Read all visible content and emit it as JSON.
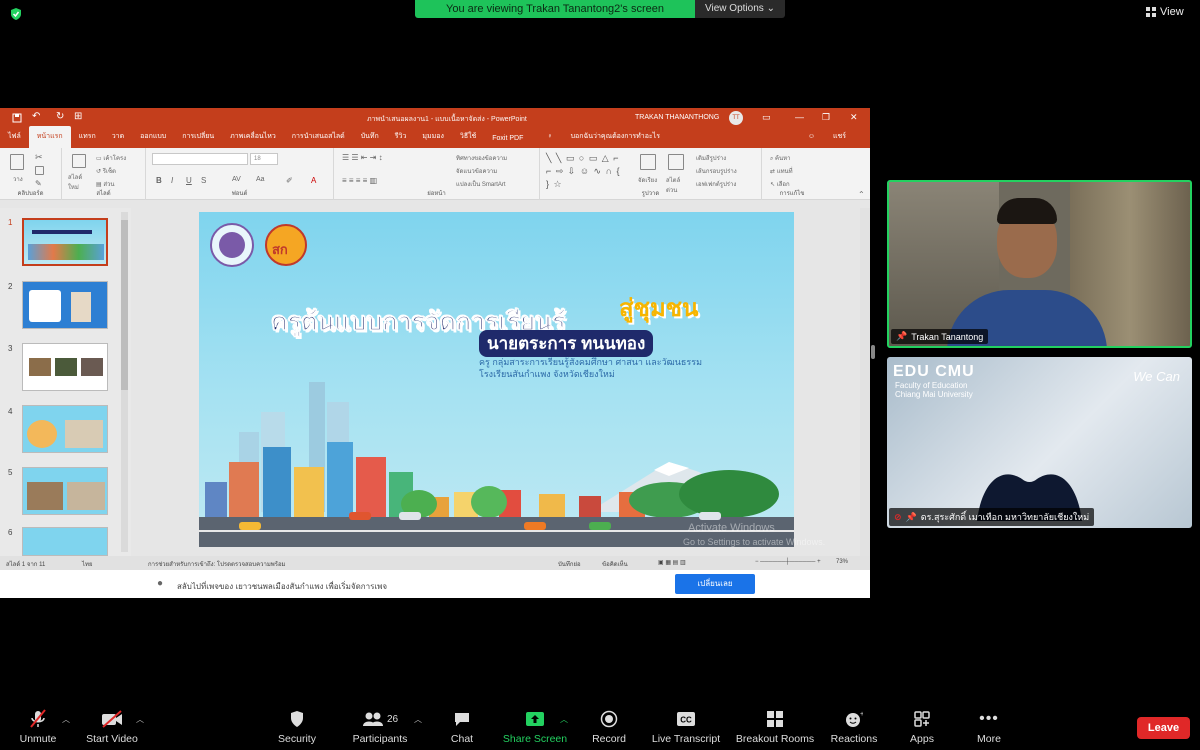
{
  "banner": {
    "text": "You are viewing Trakan Tanantong2's screen",
    "view_options": "View Options"
  },
  "view_button": "View",
  "ppt": {
    "doc_title": "ภาพนำเสนอผลงาน1 - แบบเนื้อหาจัดส่ง - PowerPoint",
    "user_name": "TRAKAN THANANTHONG",
    "user_initials": "TT",
    "tabs": [
      "ไฟล์",
      "หน้าแรก",
      "แทรก",
      "วาด",
      "ออกแบบ",
      "การเปลี่ยน",
      "ภาพเคลื่อนไหว",
      "การนำเสนอสไลด์",
      "บันทึก",
      "รีวิว",
      "มุมมอง",
      "วิธีใช้",
      "Foxit PDF",
      "บอกฉันว่าคุณต้องการทำอะไร"
    ],
    "share_label": "แชร์",
    "ribbon": {
      "clipboard": "คลิปบอร์ด",
      "slides": "สไลด์",
      "font": "ฟอนต์",
      "paragraph": "ย่อหน้า",
      "drawing": "รูปวาด",
      "editing": "การแก้ไข",
      "font_size": "18",
      "paste": "วาง",
      "new_slide": "สไลด์ใหม่",
      "layout": "เค้าโครง",
      "reset": "รีเซ็ต",
      "section": "ส่วน",
      "text_direction": "ทิศทางของข้อความ",
      "align_text": "จัดแนวข้อความ",
      "smartart": "แปลงเป็น SmartArt",
      "arrange": "จัดเรียง",
      "quick_styles": "สไตล์ด่วน",
      "shape_fill": "เติมสีรูปร่าง",
      "shape_outline": "เส้นกรอบรูปร่าง",
      "shape_effects": "เอฟเฟกต์รูปร่าง",
      "find": "ค้นหา",
      "replace": "แทนที่",
      "select": "เลือก"
    },
    "slide_numbers": [
      "1",
      "2",
      "3",
      "4",
      "5",
      "6"
    ],
    "status": {
      "slide_counter": "สไลด์ 1 จาก 11",
      "language": "ไทย",
      "accessibility": "การช่วยสำหรับการเข้าถึง: โปรดตรวจสอบความพร้อม",
      "notes": "บันทึกย่อ",
      "comments": "ข้อคิดเห็น",
      "zoom": "73%"
    },
    "notification": {
      "text": "สลับไปที่เพจของ เยาวชนพลเมืองสันกำแพง เพื่อเริ่มจัดการเพจ",
      "button": "เปลี่ยนเลย"
    }
  },
  "slide": {
    "title_part1": "ครูต้นแบบการจัดการเรียนรู้",
    "title_part2": "สู่ชุมชน",
    "presenter": "นายตระการ ทนนทอง",
    "line1": "ครู กลุ่มสาระการเรียนรู้สังคมศึกษา ศาสนา และวัฒนธรรม",
    "line2": "โรงเรียนสันกำแพง จังหวัดเชียงใหม่",
    "logo2_text": "สก"
  },
  "watermark": {
    "line1": "Activate Windows",
    "line2": "Go to Settings to activate Windows."
  },
  "participants": {
    "p1": "Trakan Tanantong",
    "p2": "ดร.สุระศักดิ์ เมาเทือก มหาวิทยาลัยเชียงใหม่",
    "p2_logo": "EDU CMU",
    "p2_sub1": "Faculty of Education",
    "p2_sub2": "Chiang Mai University",
    "p2_brand": "We Can"
  },
  "toolbar": {
    "unmute": "Unmute",
    "start_video": "Start Video",
    "security": "Security",
    "participants": "Participants",
    "participants_count": "26",
    "chat": "Chat",
    "share_screen": "Share Screen",
    "record": "Record",
    "live_transcript": "Live Transcript",
    "breakout_rooms": "Breakout Rooms",
    "reactions": "Reactions",
    "apps": "Apps",
    "more": "More",
    "leave": "Leave"
  },
  "colors": {
    "ppt_accent": "#c43e1c",
    "zoom_green": "#23d160",
    "leave_red": "#e02828"
  }
}
